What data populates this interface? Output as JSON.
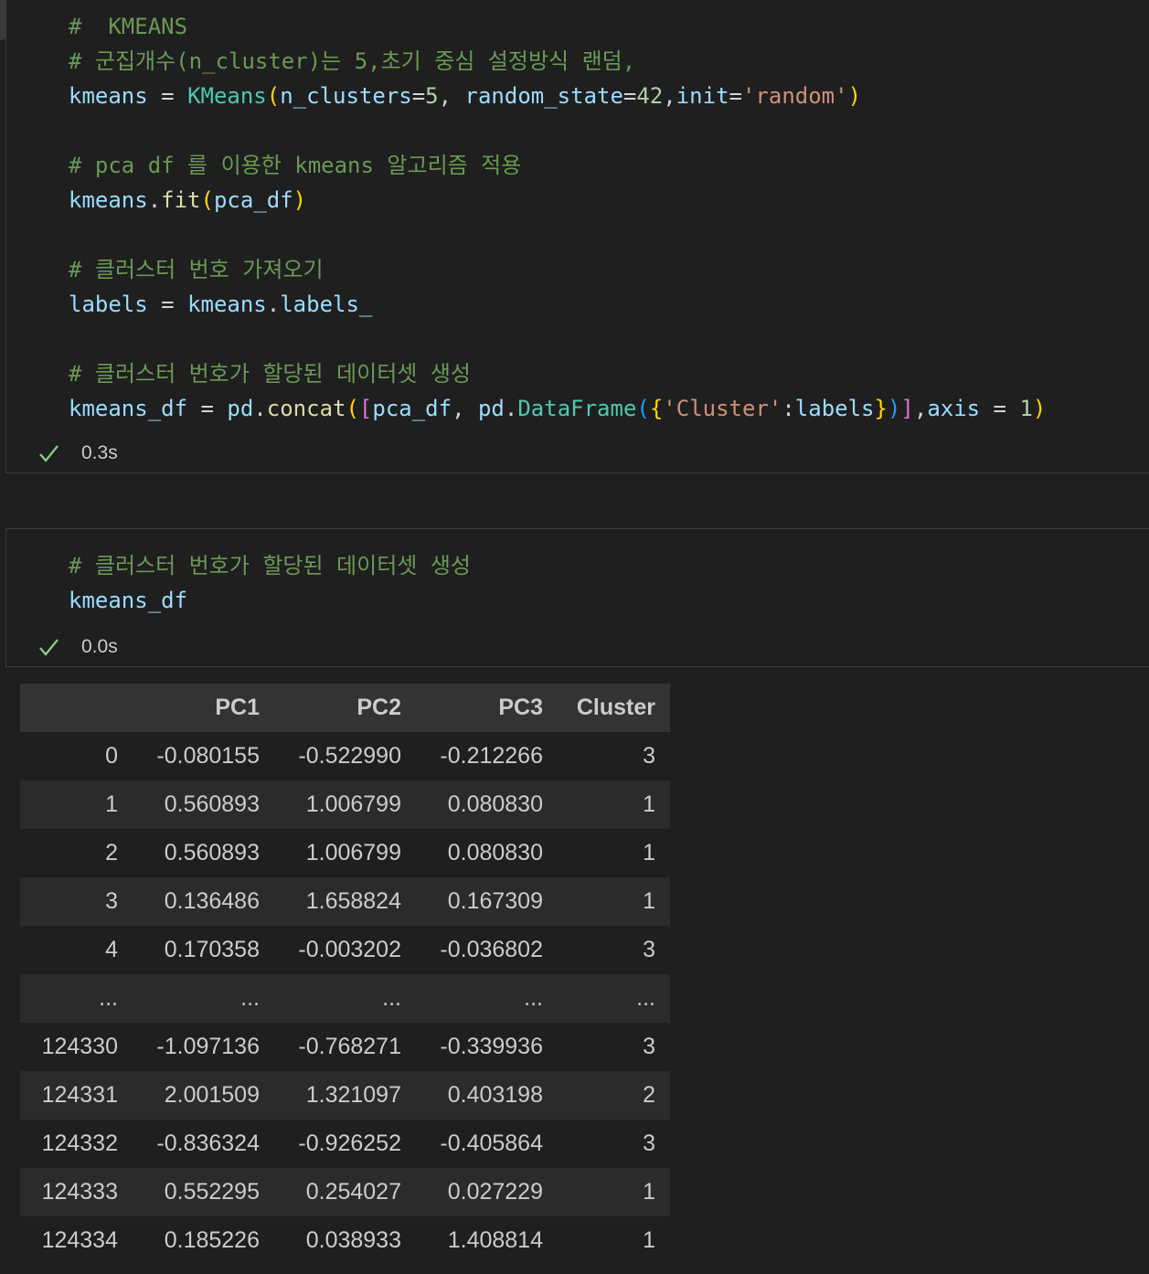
{
  "cell1": {
    "lines": [
      [
        {
          "t": "#  KMEANS",
          "c": "cm"
        }
      ],
      [
        {
          "t": "# 군집개수(n_cluster)는 5,초기 중심 설정방식 랜덤,",
          "c": "cm"
        }
      ],
      [
        {
          "t": "kmeans",
          "c": "var"
        },
        {
          "t": " = ",
          "c": "op"
        },
        {
          "t": "KMeans",
          "c": "cls"
        },
        {
          "t": "(",
          "c": "p1"
        },
        {
          "t": "n_clusters",
          "c": "var"
        },
        {
          "t": "=",
          "c": "op"
        },
        {
          "t": "5",
          "c": "num"
        },
        {
          "t": ", ",
          "c": "op"
        },
        {
          "t": "random_state",
          "c": "var"
        },
        {
          "t": "=",
          "c": "op"
        },
        {
          "t": "42",
          "c": "num"
        },
        {
          "t": ",",
          "c": "op"
        },
        {
          "t": "init",
          "c": "var"
        },
        {
          "t": "=",
          "c": "op"
        },
        {
          "t": "'random'",
          "c": "str"
        },
        {
          "t": ")",
          "c": "p1"
        }
      ],
      [],
      [
        {
          "t": "# pca df 를 이용한 kmeans 알고리즘 적용",
          "c": "cm"
        }
      ],
      [
        {
          "t": "kmeans",
          "c": "var"
        },
        {
          "t": ".",
          "c": "op"
        },
        {
          "t": "fit",
          "c": "fn"
        },
        {
          "t": "(",
          "c": "p1"
        },
        {
          "t": "pca_df",
          "c": "var"
        },
        {
          "t": ")",
          "c": "p1"
        }
      ],
      [],
      [
        {
          "t": "# 클러스터 번호 가져오기",
          "c": "cm"
        }
      ],
      [
        {
          "t": "labels",
          "c": "var"
        },
        {
          "t": " = ",
          "c": "op"
        },
        {
          "t": "kmeans",
          "c": "var"
        },
        {
          "t": ".",
          "c": "op"
        },
        {
          "t": "labels_",
          "c": "var"
        }
      ],
      [],
      [
        {
          "t": "# 클러스터 번호가 할당된 데이터셋 생성",
          "c": "cm"
        }
      ],
      [
        {
          "t": "kmeans_df",
          "c": "var"
        },
        {
          "t": " = ",
          "c": "op"
        },
        {
          "t": "pd",
          "c": "var"
        },
        {
          "t": ".",
          "c": "op"
        },
        {
          "t": "concat",
          "c": "fn"
        },
        {
          "t": "(",
          "c": "p1"
        },
        {
          "t": "[",
          "c": "p2"
        },
        {
          "t": "pca_df",
          "c": "var"
        },
        {
          "t": ", ",
          "c": "op"
        },
        {
          "t": "pd",
          "c": "var"
        },
        {
          "t": ".",
          "c": "op"
        },
        {
          "t": "DataFrame",
          "c": "cls"
        },
        {
          "t": "(",
          "c": "p3"
        },
        {
          "t": "{",
          "c": "p1"
        },
        {
          "t": "'Cluster'",
          "c": "str"
        },
        {
          "t": ":",
          "c": "op"
        },
        {
          "t": "labels",
          "c": "var"
        },
        {
          "t": "}",
          "c": "p1"
        },
        {
          "t": ")",
          "c": "p3"
        },
        {
          "t": "]",
          "c": "p2"
        },
        {
          "t": ",",
          "c": "op"
        },
        {
          "t": "axis",
          "c": "var"
        },
        {
          "t": " = ",
          "c": "op"
        },
        {
          "t": "1",
          "c": "num"
        },
        {
          "t": ")",
          "c": "p1"
        }
      ]
    ],
    "status_time": "0.3s"
  },
  "cell2": {
    "lines": [
      [
        {
          "t": "# 클러스터 번호가 할당된 데이터셋 생성",
          "c": "cm"
        }
      ],
      [
        {
          "t": "kmeans_df",
          "c": "var"
        }
      ]
    ],
    "status_time": "0.0s"
  },
  "output_table": {
    "columns": [
      "",
      "PC1",
      "PC2",
      "PC3",
      "Cluster"
    ],
    "rows": [
      [
        "0",
        "-0.080155",
        "-0.522990",
        "-0.212266",
        "3"
      ],
      [
        "1",
        "0.560893",
        "1.006799",
        "0.080830",
        "1"
      ],
      [
        "2",
        "0.560893",
        "1.006799",
        "0.080830",
        "1"
      ],
      [
        "3",
        "0.136486",
        "1.658824",
        "0.167309",
        "1"
      ],
      [
        "4",
        "0.170358",
        "-0.003202",
        "-0.036802",
        "3"
      ],
      [
        "...",
        "...",
        "...",
        "...",
        "..."
      ],
      [
        "124330",
        "-1.097136",
        "-0.768271",
        "-0.339936",
        "3"
      ],
      [
        "124331",
        "2.001509",
        "1.321097",
        "0.403198",
        "2"
      ],
      [
        "124332",
        "-0.836324",
        "-0.926252",
        "-0.405864",
        "3"
      ],
      [
        "124333",
        "0.552295",
        "0.254027",
        "0.027229",
        "1"
      ],
      [
        "124334",
        "0.185226",
        "0.038933",
        "1.408814",
        "1"
      ]
    ]
  },
  "colors": {
    "background": "#1f1f1f",
    "comment": "#6a9955",
    "variable": "#9cdcfe",
    "class": "#4ec9b0",
    "function": "#dcdcaa",
    "string": "#ce9178",
    "number": "#b5cea8",
    "success_check": "#89d185"
  },
  "icons": {
    "status": "check-icon"
  }
}
